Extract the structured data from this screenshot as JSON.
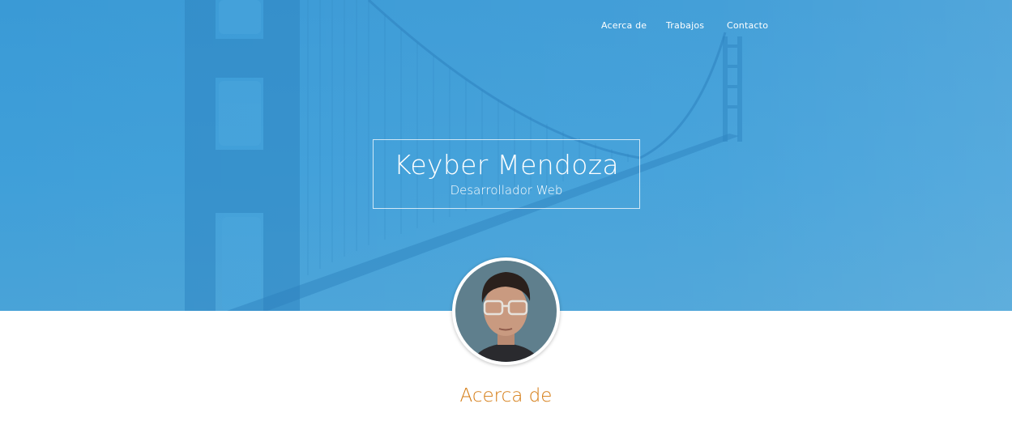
{
  "nav": {
    "items": [
      {
        "label": "Acerca de"
      },
      {
        "label": "Trabajos"
      },
      {
        "label": "Contacto"
      }
    ]
  },
  "hero": {
    "name": "Keyber Mendoza",
    "role": "Desarrollador Web",
    "background_color": "#3f9fd9",
    "background_icon": "golden-gate-bridge-photo"
  },
  "profile": {
    "avatar_icon": "profile-photo"
  },
  "about": {
    "title": "Acerca de",
    "title_color": "#d4790f"
  }
}
